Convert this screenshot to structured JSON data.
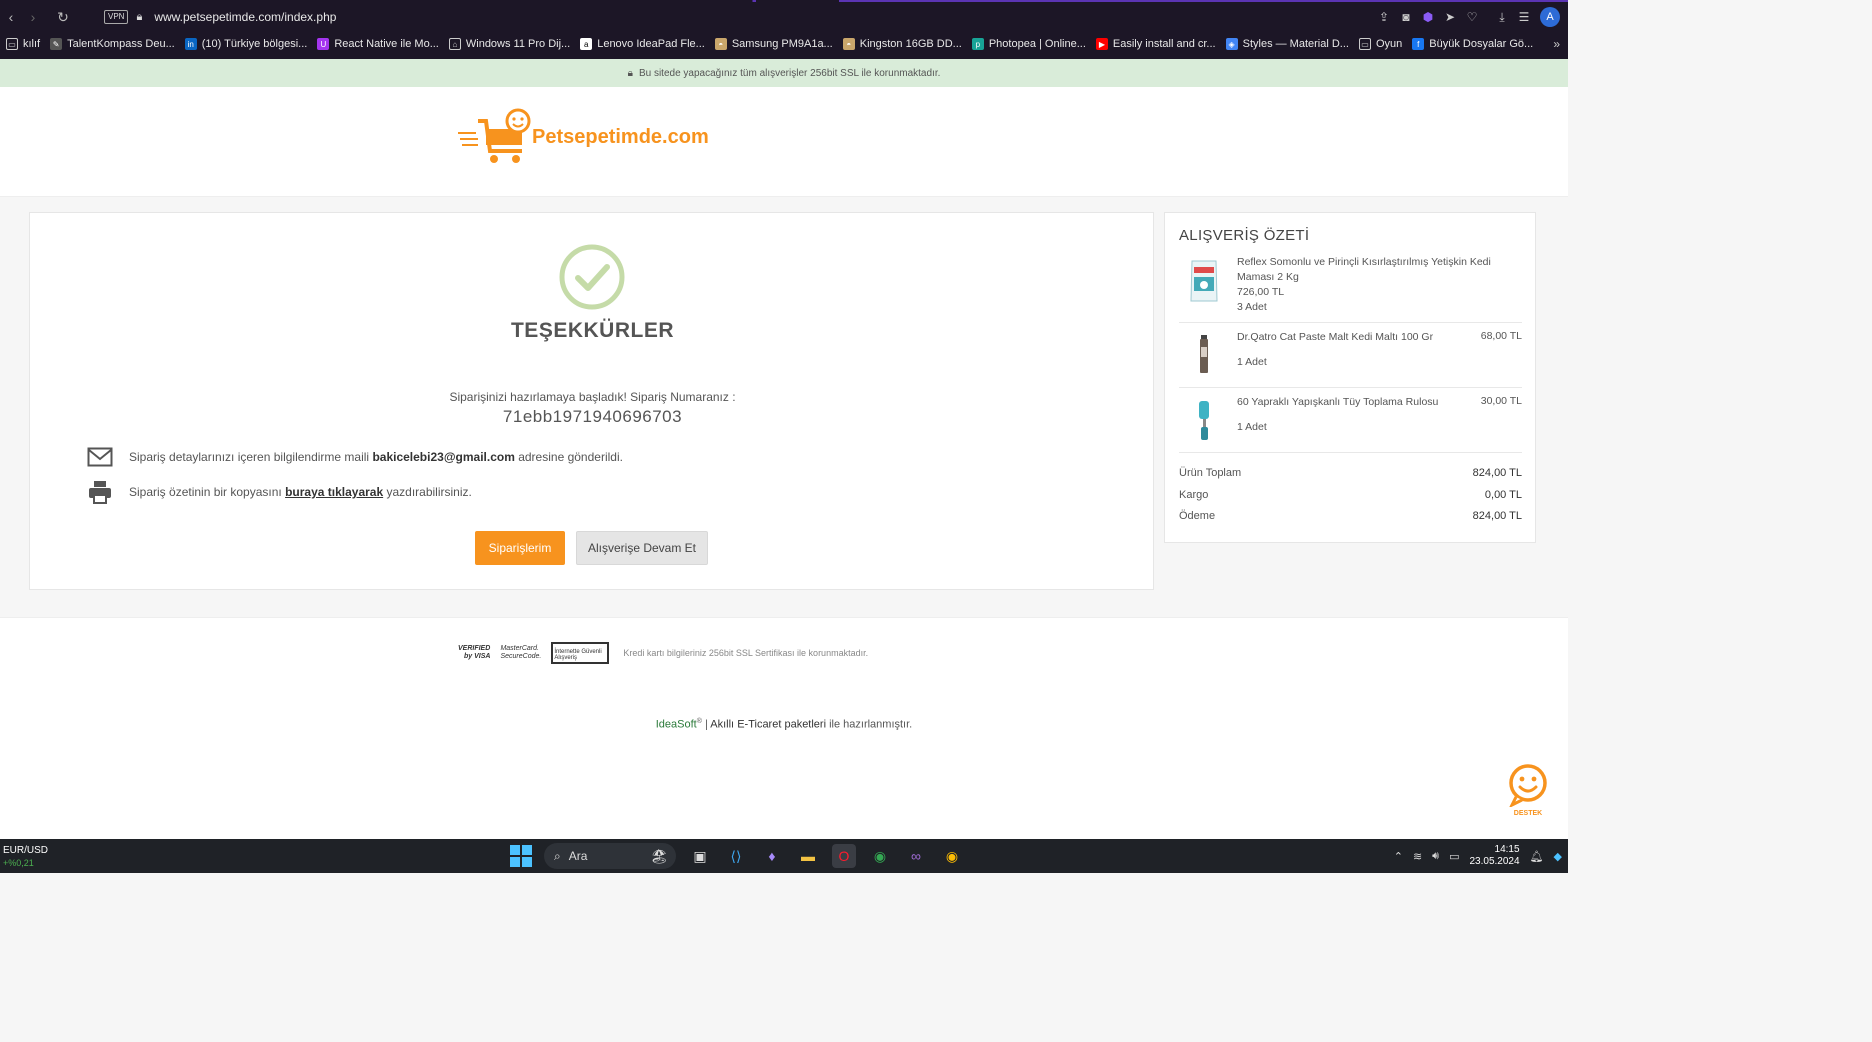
{
  "browser": {
    "vpn_label": "VPN",
    "url": "www.petsepetimde.com/index.php",
    "avatar_initial": "A",
    "bookmarks": [
      {
        "label": "kılıf",
        "icon": "folder-icon",
        "color": "#1c1626"
      },
      {
        "label": "TalentKompass Deu...",
        "icon": "pen-icon",
        "color": "#555555"
      },
      {
        "label": "(10) Türkiye bölgesi...",
        "icon": "linkedin-icon",
        "color": "#0a66c2"
      },
      {
        "label": "React Native ile Mo...",
        "icon": "udemy-icon",
        "color": "#a435f0"
      },
      {
        "label": "Windows 11 Pro Dij...",
        "icon": "bag-icon",
        "color": "#1c1626"
      },
      {
        "label": "Lenovo IdeaPad Fle...",
        "icon": "amazon-icon",
        "color": "#ffffff"
      },
      {
        "label": "Samsung PM9A1a...",
        "icon": "store-icon",
        "color": "#c9a66b"
      },
      {
        "label": "Kingston 16GB DD...",
        "icon": "store-icon",
        "color": "#c9a66b"
      },
      {
        "label": "Photopea | Online...",
        "icon": "photopea-icon",
        "color": "#18a497"
      },
      {
        "label": "Easily install and cr...",
        "icon": "youtube-icon",
        "color": "#ff0000"
      },
      {
        "label": "Styles — Material D...",
        "icon": "material-icon",
        "color": "#4285f4"
      },
      {
        "label": "Oyun",
        "icon": "folder-icon",
        "color": "#1c1626"
      },
      {
        "label": "Büyük Dosyalar Gö...",
        "icon": "facebook-icon",
        "color": "#1877f2"
      }
    ]
  },
  "ssl_notice": "Bu sitede yapacağınız tüm alışverişler 256bit SSL ile korunmaktadır.",
  "site": {
    "logo_text": "Petsepetimde.com",
    "brand_color": "#f7931e"
  },
  "confirmation": {
    "title": "TEŞEKKÜRLER",
    "order_message": "Siparişinizi hazırlamaya başladık! Sipariş Numaranız :",
    "order_number": "71ebb1971940696703",
    "mail_prefix": "Sipariş detaylarınızı içeren bilgilendirme maili ",
    "mail_address": "bakicelebi23@gmail.com",
    "mail_suffix": " adresine gönderildi.",
    "print_prefix": "Sipariş özetinin bir kopyasını ",
    "print_link": "buraya tıklayarak",
    "print_suffix": " yazdırabilirsiniz.",
    "btn_orders": "Siparişlerim",
    "btn_continue": "Alışverişe Devam Et"
  },
  "summary": {
    "title": "ALIŞVERİŞ ÖZETİ",
    "items": [
      {
        "name": "Reflex Somonlu ve Pirinçli Kısırlaştırılmış Yetişkin Kedi Maması 2 Kg",
        "price": "726,00 TL",
        "qty": "3 Adet"
      },
      {
        "name": "Dr.Qatro Cat Paste Malt Kedi Maltı 100 Gr",
        "price": "68,00 TL",
        "qty": "1 Adet"
      },
      {
        "name": "60 Yapraklı Yapışkanlı Tüy Toplama Rulosu",
        "price": "30,00 TL",
        "qty": "1 Adet"
      }
    ],
    "totals": [
      {
        "label": "Ürün Toplam",
        "value": "824,00 TL"
      },
      {
        "label": "Kargo",
        "value": "0,00 TL"
      },
      {
        "label": "Ödeme",
        "value": "824,00 TL"
      }
    ]
  },
  "footer": {
    "visa_line1": "VERIFIED",
    "visa_line2": "by VISA",
    "mc_line1": "MasterCard.",
    "mc_line2": "SecureCode.",
    "safe_label": "İnternette Güvenli Alışveriş",
    "ssl_card_note": "Kredi kartı bilgileriniz 256bit SSL Sertifikası ile korunmaktadır.",
    "ideasoft": "IdeaSoft",
    "reg": "®",
    "sep": " | ",
    "akilli": "Akıllı ",
    "eticaret": "E-Ticaret paketleri",
    "suffix": " ile hazırlanmıştır.",
    "support_label": "DESTEK"
  },
  "taskbar": {
    "ticker_pair": "EUR/USD",
    "ticker_change": "+%0,21",
    "search_label": "Ara",
    "time": "14:15",
    "date": "23.05.2024"
  }
}
